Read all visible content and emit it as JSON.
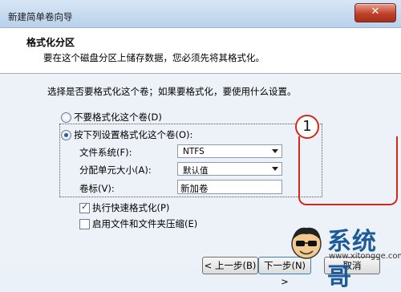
{
  "window": {
    "title": "新建简单卷向导",
    "close_glyph": "✕"
  },
  "header": {
    "title": "格式化分区",
    "subtitle": "要在这个磁盘分区上储存数据，您必须先将其格式化。"
  },
  "body": {
    "question": "选择是否要格式化这个卷；如果要格式化，要使用什么设置。",
    "options": {
      "no_format": "不要格式化这个卷(D)",
      "format": "按下列设置格式化这个卷(O):"
    },
    "fields": {
      "filesystem_label": "文件系统(F):",
      "filesystem_value": "NTFS",
      "allocation_label": "分配单元大小(A):",
      "allocation_value": "默认值",
      "volume_label_label": "卷标(V):",
      "volume_label_value": "新加卷"
    },
    "checkboxes": {
      "quick_format": "执行快速格式化(P)",
      "compression": "启用文件和文件夹压缩(E)"
    }
  },
  "annotation": {
    "number": "1",
    "color": "#d02a1f"
  },
  "footer": {
    "back": "< 上一步(B)",
    "next": "下一步(N) >",
    "cancel": "取消"
  },
  "watermark": {
    "name": "系统哥",
    "url": "www.xitongge.com"
  }
}
